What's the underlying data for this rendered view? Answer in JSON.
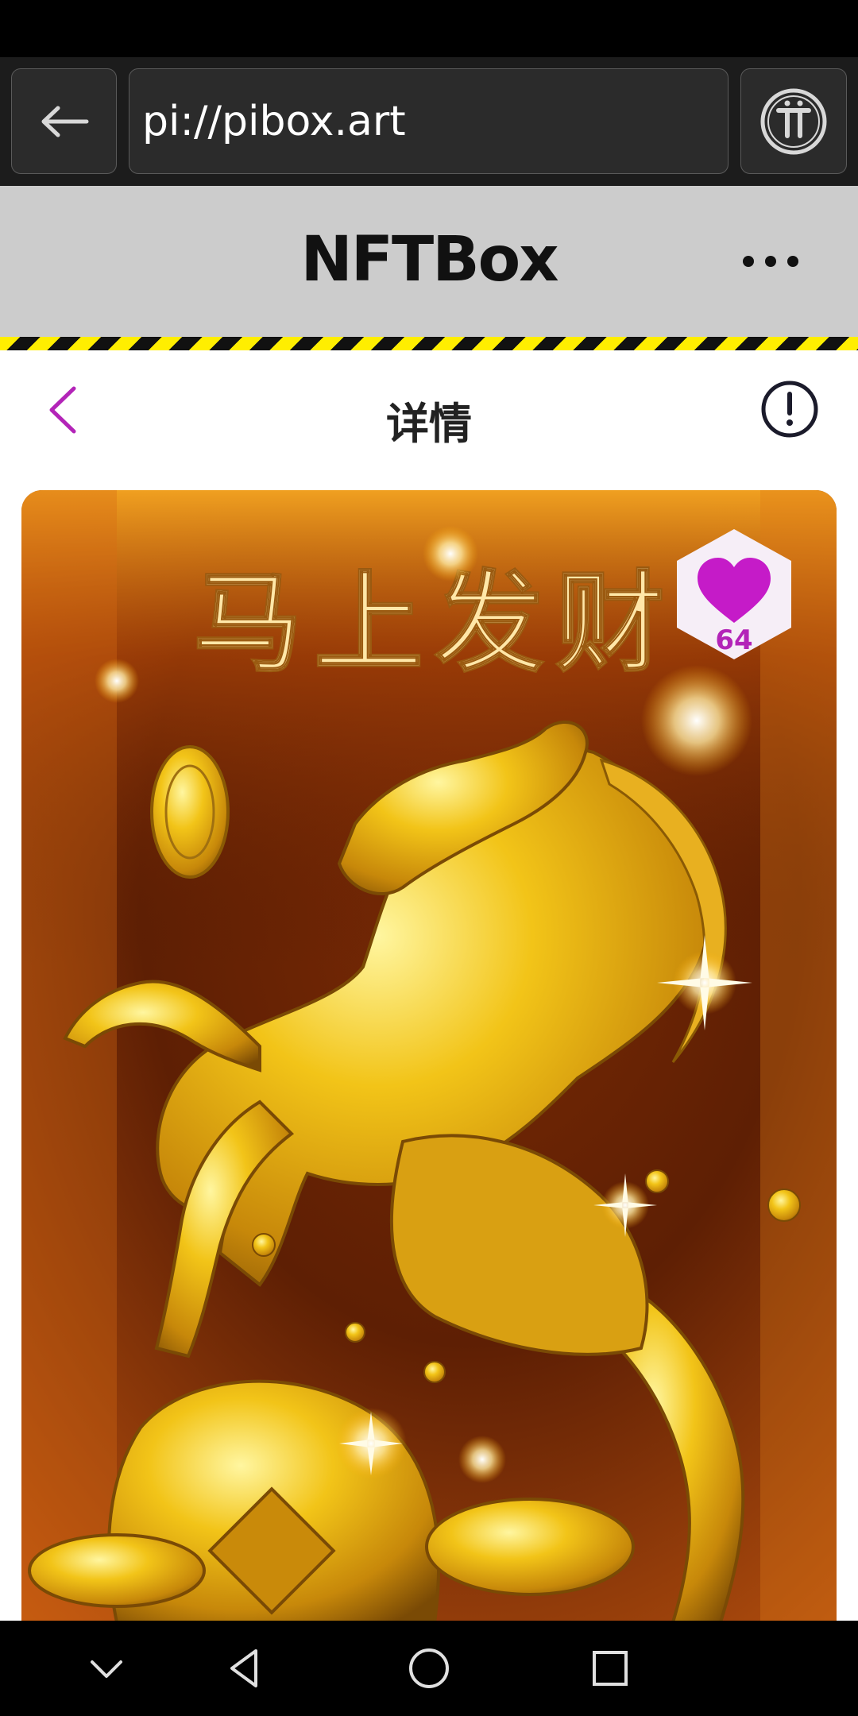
{
  "browser": {
    "url": "pi://pibox.art",
    "back_icon": "arrow-left-icon",
    "pi_icon": "pi-logo-icon"
  },
  "app": {
    "title": "NFTBox",
    "menu_icon": "more-horizontal-icon"
  },
  "page": {
    "title": "详情",
    "back_icon": "chevron-left-icon",
    "info_icon": "info-circle-icon"
  },
  "artwork": {
    "caption": "马上发财"
  },
  "like": {
    "count": "64",
    "icon": "heart-icon"
  },
  "colors": {
    "accent": "#b324b8",
    "hazard_yellow": "#ffee00",
    "header_gray": "#cccccc"
  },
  "system_nav": {
    "icons": [
      "chevron-down-icon",
      "back-triangle-icon",
      "home-circle-icon",
      "recents-square-icon"
    ]
  }
}
